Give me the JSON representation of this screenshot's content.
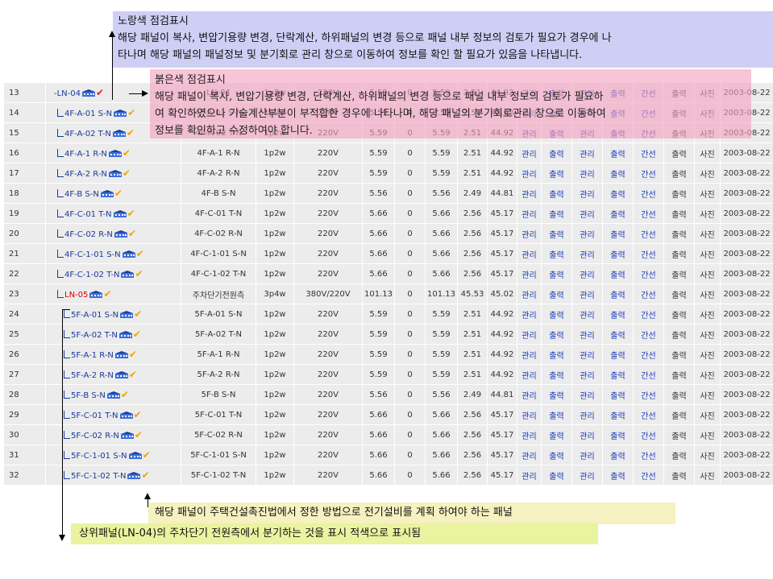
{
  "callouts": {
    "yellow": {
      "title": "노랑색 점검표시",
      "line1": "해당 패널이 복사, 변압기용량 변경, 단락계산, 하위패널의 변경 등으로 패널 내부 정보의 검토가 필요가 경우에 나",
      "line2": "타나며 해당 패널의 패널정보 및 분기회로 관리 창으로 이동하여 정보를 확인 할 필요가 있음을 나타냅니다."
    },
    "red": {
      "title": "붉은색 점검표시",
      "line1": "해당 패널이 복사, 변압기용량 변경, 단락계산, 하위패널의 변경 등으로 패널 내부 정보의 검토가 필요하",
      "line2": "여 확인하였으나 기술계산부분이 부적합한 경우에 나타나며, 해당 패널의 분기회로관리 창으로 이동하여",
      "line3": "정보를 확인하고 수정하여야 합니다."
    },
    "bottom1": "해당 패널이 주택건설촉진법에서 정한 방법으로 전기설비를 계획 하여야 하는 패널",
    "bottom2": "상위패널(LN-04)의 주차단기 전원측에서 분기하는 것을 표시 적색으로 표시됨"
  },
  "icons": {
    "house": "house-icon",
    "check": "check-icon"
  },
  "colors": {
    "link": "#1838b8",
    "warn_yellow": "#f0a400",
    "warn_red": "#e02020",
    "tree_red": "#d60000"
  },
  "table": {
    "rows": [
      {
        "no": "13",
        "name": "LN-04",
        "tree": "top",
        "check": "red",
        "panel": "LN-04",
        "phase": "1p2w",
        "volt": "220V",
        "a": "5.59",
        "b": "0",
        "c": "5.59",
        "d": "2.51",
        "e": "44.92",
        "l1": "관리",
        "l2": "출력",
        "l3": "관리",
        "l4": "출력",
        "l5": "간선",
        "l6": "출력",
        "l7": "사진",
        "date": "2003-08-22"
      },
      {
        "no": "14",
        "name": "4F-A-01 S-N",
        "tree": "child",
        "check": "yellow",
        "panel": "4F-A-01 S-N",
        "phase": "1p2w",
        "volt": "220V",
        "a": "5.59",
        "b": "0",
        "c": "5.59",
        "d": "2.51",
        "e": "44.92",
        "l1": "관리",
        "l2": "출력",
        "l3": "관리",
        "l4": "출력",
        "l5": "간선",
        "l6": "출력",
        "l7": "사진",
        "date": "2003-08-22"
      },
      {
        "no": "15",
        "name": "4F-A-02 T-N",
        "tree": "child",
        "check": "yellow",
        "panel": "4F-A-02 T-N",
        "phase": "1p2w",
        "volt": "220V",
        "a": "5.59",
        "b": "0",
        "c": "5.59",
        "d": "2.51",
        "e": "44.92",
        "l1": "관리",
        "l2": "출력",
        "l3": "관리",
        "l4": "출력",
        "l5": "간선",
        "l6": "출력",
        "l7": "사진",
        "date": "2003-08-22"
      },
      {
        "no": "16",
        "name": "4F-A-1 R-N",
        "tree": "child",
        "check": "yellow",
        "panel": "4F-A-1 R-N",
        "phase": "1p2w",
        "volt": "220V",
        "a": "5.59",
        "b": "0",
        "c": "5.59",
        "d": "2.51",
        "e": "44.92",
        "l1": "관리",
        "l2": "출력",
        "l3": "관리",
        "l4": "출력",
        "l5": "간선",
        "l6": "출력",
        "l7": "사진",
        "date": "2003-08-22"
      },
      {
        "no": "17",
        "name": "4F-A-2 R-N",
        "tree": "child",
        "check": "yellow",
        "panel": "4F-A-2 R-N",
        "phase": "1p2w",
        "volt": "220V",
        "a": "5.59",
        "b": "0",
        "c": "5.59",
        "d": "2.51",
        "e": "44.92",
        "l1": "관리",
        "l2": "출력",
        "l3": "관리",
        "l4": "출력",
        "l5": "간선",
        "l6": "출력",
        "l7": "사진",
        "date": "2003-08-22"
      },
      {
        "no": "18",
        "name": "4F-B S-N",
        "tree": "child",
        "check": "yellow",
        "panel": "4F-B S-N",
        "phase": "1p2w",
        "volt": "220V",
        "a": "5.56",
        "b": "0",
        "c": "5.56",
        "d": "2.49",
        "e": "44.81",
        "l1": "관리",
        "l2": "출력",
        "l3": "관리",
        "l4": "출력",
        "l5": "간선",
        "l6": "출력",
        "l7": "사진",
        "date": "2003-08-22"
      },
      {
        "no": "19",
        "name": "4F-C-01 T-N",
        "tree": "child",
        "check": "yellow",
        "panel": "4F-C-01 T-N",
        "phase": "1p2w",
        "volt": "220V",
        "a": "5.66",
        "b": "0",
        "c": "5.66",
        "d": "2.56",
        "e": "45.17",
        "l1": "관리",
        "l2": "출력",
        "l3": "관리",
        "l4": "출력",
        "l5": "간선",
        "l6": "출력",
        "l7": "사진",
        "date": "2003-08-22"
      },
      {
        "no": "20",
        "name": "4F-C-02 R-N",
        "tree": "child",
        "check": "yellow",
        "panel": "4F-C-02 R-N",
        "phase": "1p2w",
        "volt": "220V",
        "a": "5.66",
        "b": "0",
        "c": "5.66",
        "d": "2.56",
        "e": "45.17",
        "l1": "관리",
        "l2": "출력",
        "l3": "관리",
        "l4": "출력",
        "l5": "간선",
        "l6": "출력",
        "l7": "사진",
        "date": "2003-08-22"
      },
      {
        "no": "21",
        "name": "4F-C-1-01 S-N",
        "tree": "child",
        "check": "yellow",
        "panel": "4F-C-1-01 S-N",
        "phase": "1p2w",
        "volt": "220V",
        "a": "5.66",
        "b": "0",
        "c": "5.66",
        "d": "2.56",
        "e": "45.17",
        "l1": "관리",
        "l2": "출력",
        "l3": "관리",
        "l4": "출력",
        "l5": "간선",
        "l6": "출력",
        "l7": "사진",
        "date": "2003-08-22"
      },
      {
        "no": "22",
        "name": "4F-C-1-02 T-N",
        "tree": "child",
        "check": "yellow",
        "panel": "4F-C-1-02 T-N",
        "phase": "1p2w",
        "volt": "220V",
        "a": "5.66",
        "b": "0",
        "c": "5.66",
        "d": "2.56",
        "e": "45.17",
        "l1": "관리",
        "l2": "출력",
        "l3": "관리",
        "l4": "출력",
        "l5": "간선",
        "l6": "출력",
        "l7": "사진",
        "date": "2003-08-22"
      },
      {
        "no": "23",
        "name": "LN-05",
        "tree": "red",
        "check": "yellow",
        "panel": "주차단기전원측",
        "phase": "3p4w",
        "volt": "380V/220V",
        "a": "101.13",
        "b": "0",
        "c": "101.13",
        "d": "45.53",
        "e": "45.02",
        "l1": "관리",
        "l2": "출력",
        "l3": "관리",
        "l4": "출력",
        "l5": "간선",
        "l6": "출력",
        "l7": "사진",
        "date": "2003-08-22"
      },
      {
        "no": "24",
        "name": "5F-A-01 S-N",
        "tree": "child2",
        "check": "yellow",
        "panel": "5F-A-01 S-N",
        "phase": "1p2w",
        "volt": "220V",
        "a": "5.59",
        "b": "0",
        "c": "5.59",
        "d": "2.51",
        "e": "44.92",
        "l1": "관리",
        "l2": "출력",
        "l3": "관리",
        "l4": "출력",
        "l5": "간선",
        "l6": "출력",
        "l7": "사진",
        "date": "2003-08-22"
      },
      {
        "no": "25",
        "name": "5F-A-02 T-N",
        "tree": "child2",
        "check": "yellow",
        "panel": "5F-A-02 T-N",
        "phase": "1p2w",
        "volt": "220V",
        "a": "5.59",
        "b": "0",
        "c": "5.59",
        "d": "2.51",
        "e": "44.92",
        "l1": "관리",
        "l2": "출력",
        "l3": "관리",
        "l4": "출력",
        "l5": "간선",
        "l6": "출력",
        "l7": "사진",
        "date": "2003-08-22"
      },
      {
        "no": "26",
        "name": "5F-A-1 R-N",
        "tree": "child2",
        "check": "yellow",
        "panel": "5F-A-1 R-N",
        "phase": "1p2w",
        "volt": "220V",
        "a": "5.59",
        "b": "0",
        "c": "5.59",
        "d": "2.51",
        "e": "44.92",
        "l1": "관리",
        "l2": "출력",
        "l3": "관리",
        "l4": "출력",
        "l5": "간선",
        "l6": "출력",
        "l7": "사진",
        "date": "2003-08-22"
      },
      {
        "no": "27",
        "name": "5F-A-2 R-N",
        "tree": "child2",
        "check": "yellow",
        "panel": "5F-A-2 R-N",
        "phase": "1p2w",
        "volt": "220V",
        "a": "5.59",
        "b": "0",
        "c": "5.59",
        "d": "2.51",
        "e": "44.92",
        "l1": "관리",
        "l2": "출력",
        "l3": "관리",
        "l4": "출력",
        "l5": "간선",
        "l6": "출력",
        "l7": "사진",
        "date": "2003-08-22"
      },
      {
        "no": "28",
        "name": "5F-B S-N",
        "tree": "child2",
        "check": "yellow",
        "panel": "5F-B S-N",
        "phase": "1p2w",
        "volt": "220V",
        "a": "5.56",
        "b": "0",
        "c": "5.56",
        "d": "2.49",
        "e": "44.81",
        "l1": "관리",
        "l2": "출력",
        "l3": "관리",
        "l4": "출력",
        "l5": "간선",
        "l6": "출력",
        "l7": "사진",
        "date": "2003-08-22"
      },
      {
        "no": "29",
        "name": "5F-C-01 T-N",
        "tree": "child2",
        "check": "yellow",
        "panel": "5F-C-01 T-N",
        "phase": "1p2w",
        "volt": "220V",
        "a": "5.66",
        "b": "0",
        "c": "5.66",
        "d": "2.56",
        "e": "45.17",
        "l1": "관리",
        "l2": "출력",
        "l3": "관리",
        "l4": "출력",
        "l5": "간선",
        "l6": "출력",
        "l7": "사진",
        "date": "2003-08-22"
      },
      {
        "no": "30",
        "name": "5F-C-02 R-N",
        "tree": "child2",
        "check": "yellow",
        "panel": "5F-C-02 R-N",
        "phase": "1p2w",
        "volt": "220V",
        "a": "5.66",
        "b": "0",
        "c": "5.66",
        "d": "2.56",
        "e": "45.17",
        "l1": "관리",
        "l2": "출력",
        "l3": "관리",
        "l4": "출력",
        "l5": "간선",
        "l6": "출력",
        "l7": "사진",
        "date": "2003-08-22"
      },
      {
        "no": "31",
        "name": "5F-C-1-01 S-N",
        "tree": "child2",
        "check": "yellow",
        "panel": "5F-C-1-01 S-N",
        "phase": "1p2w",
        "volt": "220V",
        "a": "5.66",
        "b": "0",
        "c": "5.66",
        "d": "2.56",
        "e": "45.17",
        "l1": "관리",
        "l2": "출력",
        "l3": "관리",
        "l4": "출력",
        "l5": "간선",
        "l6": "출력",
        "l7": "사진",
        "date": "2003-08-22"
      },
      {
        "no": "32",
        "name": "5F-C-1-02 T-N",
        "tree": "child2",
        "check": "yellow",
        "panel": "5F-C-1-02 T-N",
        "phase": "1p2w",
        "volt": "220V",
        "a": "5.66",
        "b": "0",
        "c": "5.66",
        "d": "2.56",
        "e": "45.17",
        "l1": "관리",
        "l2": "출력",
        "l3": "관리",
        "l4": "출력",
        "l5": "간선",
        "l6": "출력",
        "l7": "사진",
        "date": "2003-08-22"
      }
    ]
  }
}
